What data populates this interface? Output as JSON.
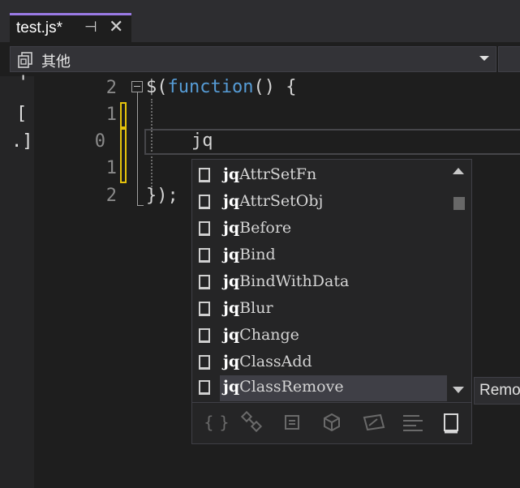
{
  "tab": {
    "title": "test.js*",
    "pin_icon": "pin-icon",
    "close_icon": "close-icon"
  },
  "navbar": {
    "label": "其他",
    "icon": "project-icon"
  },
  "margin_chars": [
    "'",
    "[",
    ".]"
  ],
  "line_numbers": [
    "2",
    "1",
    "0",
    "1",
    "2"
  ],
  "code": {
    "line1_dollar": "$(",
    "line1_keyword": "function",
    "line1_rest": "() {",
    "current_line": "jq",
    "line5": "});"
  },
  "completion": {
    "typed_prefix": "jq",
    "items": [
      {
        "prefix": "jq",
        "rest": "AttrSetFn"
      },
      {
        "prefix": "jq",
        "rest": "AttrSetObj"
      },
      {
        "prefix": "jq",
        "rest": "Before"
      },
      {
        "prefix": "jq",
        "rest": "Bind"
      },
      {
        "prefix": "jq",
        "rest": "BindWithData"
      },
      {
        "prefix": "jq",
        "rest": "Blur"
      },
      {
        "prefix": "jq",
        "rest": "Change"
      },
      {
        "prefix": "jq",
        "rest": "ClassAdd"
      },
      {
        "prefix": "jq",
        "rest": "ClassRemove"
      }
    ],
    "selected_index": 8,
    "filter_icons": [
      "braces-icon",
      "shapes-icon",
      "method-icon",
      "cube-icon",
      "tag-icon",
      "field-icon",
      "snippet-icon"
    ]
  },
  "tooltip": {
    "text": "Remove"
  },
  "colors": {
    "accent": "#9a7ae5",
    "keyword": "#569cd6",
    "change_marker": "#e5c30c"
  }
}
